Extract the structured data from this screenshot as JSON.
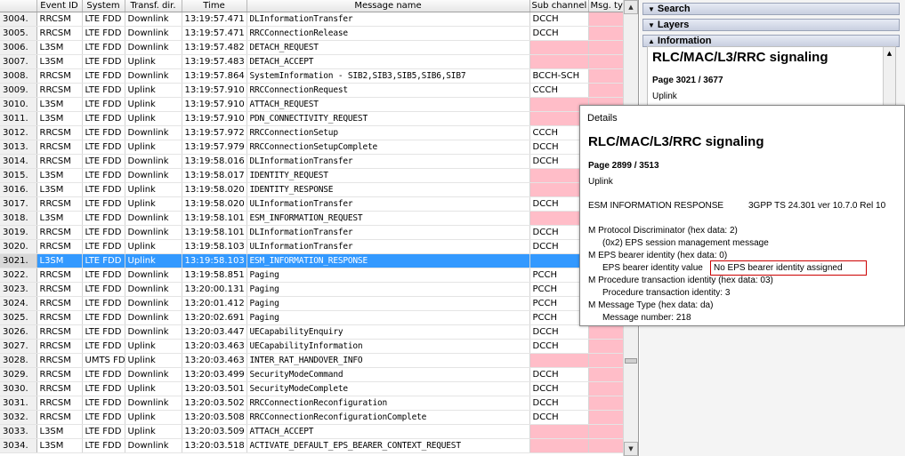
{
  "table": {
    "columns": [
      "",
      "Event ID",
      "System",
      "Transf. dir.",
      "Time",
      "Message name",
      "Sub channel",
      "Msg. ty"
    ],
    "rows": [
      {
        "num": "3004.",
        "event": "RRCSM",
        "system": "LTE FDD",
        "dir": "Downlink",
        "time": "13:19:57.471",
        "msg": "DLInformationTransfer",
        "sub": "DCCH"
      },
      {
        "num": "3005.",
        "event": "RRCSM",
        "system": "LTE FDD",
        "dir": "Downlink",
        "time": "13:19:57.471",
        "msg": "RRCConnectionRelease",
        "sub": "DCCH"
      },
      {
        "num": "3006.",
        "event": "L3SM",
        "system": "LTE FDD",
        "dir": "Downlink",
        "time": "13:19:57.482",
        "msg": "DETACH_REQUEST",
        "sub": ""
      },
      {
        "num": "3007.",
        "event": "L3SM",
        "system": "LTE FDD",
        "dir": "Uplink",
        "time": "13:19:57.483",
        "msg": "DETACH_ACCEPT",
        "sub": ""
      },
      {
        "num": "3008.",
        "event": "RRCSM",
        "system": "LTE FDD",
        "dir": "Downlink",
        "time": "13:19:57.864",
        "msg": "SystemInformation - SIB2,SIB3,SIB5,SIB6,SIB7",
        "sub": "BCCH-SCH"
      },
      {
        "num": "3009.",
        "event": "RRCSM",
        "system": "LTE FDD",
        "dir": "Uplink",
        "time": "13:19:57.910",
        "msg": "RRCConnectionRequest",
        "sub": "CCCH"
      },
      {
        "num": "3010.",
        "event": "L3SM",
        "system": "LTE FDD",
        "dir": "Uplink",
        "time": "13:19:57.910",
        "msg": "ATTACH_REQUEST",
        "sub": ""
      },
      {
        "num": "3011.",
        "event": "L3SM",
        "system": "LTE FDD",
        "dir": "Uplink",
        "time": "13:19:57.910",
        "msg": "PDN_CONNECTIVITY_REQUEST",
        "sub": ""
      },
      {
        "num": "3012.",
        "event": "RRCSM",
        "system": "LTE FDD",
        "dir": "Downlink",
        "time": "13:19:57.972",
        "msg": "RRCConnectionSetup",
        "sub": "CCCH"
      },
      {
        "num": "3013.",
        "event": "RRCSM",
        "system": "LTE FDD",
        "dir": "Uplink",
        "time": "13:19:57.979",
        "msg": "RRCConnectionSetupComplete",
        "sub": "DCCH"
      },
      {
        "num": "3014.",
        "event": "RRCSM",
        "system": "LTE FDD",
        "dir": "Downlink",
        "time": "13:19:58.016",
        "msg": "DLInformationTransfer",
        "sub": "DCCH"
      },
      {
        "num": "3015.",
        "event": "L3SM",
        "system": "LTE FDD",
        "dir": "Downlink",
        "time": "13:19:58.017",
        "msg": "IDENTITY_REQUEST",
        "sub": ""
      },
      {
        "num": "3016.",
        "event": "L3SM",
        "system": "LTE FDD",
        "dir": "Uplink",
        "time": "13:19:58.020",
        "msg": "IDENTITY_RESPONSE",
        "sub": ""
      },
      {
        "num": "3017.",
        "event": "RRCSM",
        "system": "LTE FDD",
        "dir": "Uplink",
        "time": "13:19:58.020",
        "msg": "ULInformationTransfer",
        "sub": "DCCH"
      },
      {
        "num": "3018.",
        "event": "L3SM",
        "system": "LTE FDD",
        "dir": "Downlink",
        "time": "13:19:58.101",
        "msg": "ESM_INFORMATION_REQUEST",
        "sub": ""
      },
      {
        "num": "3019.",
        "event": "RRCSM",
        "system": "LTE FDD",
        "dir": "Downlink",
        "time": "13:19:58.101",
        "msg": "DLInformationTransfer",
        "sub": "DCCH"
      },
      {
        "num": "3020.",
        "event": "RRCSM",
        "system": "LTE FDD",
        "dir": "Uplink",
        "time": "13:19:58.103",
        "msg": "ULInformationTransfer",
        "sub": "DCCH"
      },
      {
        "num": "3021.",
        "event": "L3SM",
        "system": "LTE FDD",
        "dir": "Uplink",
        "time": "13:19:58.103",
        "msg": "ESM_INFORMATION_RESPONSE",
        "sub": "",
        "selected": true
      },
      {
        "num": "3022.",
        "event": "RRCSM",
        "system": "LTE FDD",
        "dir": "Downlink",
        "time": "13:19:58.851",
        "msg": "Paging",
        "sub": "PCCH"
      },
      {
        "num": "3023.",
        "event": "RRCSM",
        "system": "LTE FDD",
        "dir": "Downlink",
        "time": "13:20:00.131",
        "msg": "Paging",
        "sub": "PCCH"
      },
      {
        "num": "3024.",
        "event": "RRCSM",
        "system": "LTE FDD",
        "dir": "Downlink",
        "time": "13:20:01.412",
        "msg": "Paging",
        "sub": "PCCH"
      },
      {
        "num": "3025.",
        "event": "RRCSM",
        "system": "LTE FDD",
        "dir": "Downlink",
        "time": "13:20:02.691",
        "msg": "Paging",
        "sub": "PCCH"
      },
      {
        "num": "3026.",
        "event": "RRCSM",
        "system": "LTE FDD",
        "dir": "Downlink",
        "time": "13:20:03.447",
        "msg": "UECapabilityEnquiry",
        "sub": "DCCH"
      },
      {
        "num": "3027.",
        "event": "RRCSM",
        "system": "LTE FDD",
        "dir": "Uplink",
        "time": "13:20:03.463",
        "msg": "UECapabilityInformation",
        "sub": "DCCH"
      },
      {
        "num": "3028.",
        "event": "RRCSM",
        "system": "UMTS FD",
        "dir": "Uplink",
        "time": "13:20:03.463",
        "msg": "INTER_RAT_HANDOVER_INFO",
        "sub": ""
      },
      {
        "num": "3029.",
        "event": "RRCSM",
        "system": "LTE FDD",
        "dir": "Downlink",
        "time": "13:20:03.499",
        "msg": "SecurityModeCommand",
        "sub": "DCCH"
      },
      {
        "num": "3030.",
        "event": "RRCSM",
        "system": "LTE FDD",
        "dir": "Uplink",
        "time": "13:20:03.501",
        "msg": "SecurityModeComplete",
        "sub": "DCCH"
      },
      {
        "num": "3031.",
        "event": "RRCSM",
        "system": "LTE FDD",
        "dir": "Downlink",
        "time": "13:20:03.502",
        "msg": "RRCConnectionReconfiguration",
        "sub": "DCCH"
      },
      {
        "num": "3032.",
        "event": "RRCSM",
        "system": "LTE FDD",
        "dir": "Uplink",
        "time": "13:20:03.508",
        "msg": "RRCConnectionReconfigurationComplete",
        "sub": "DCCH"
      },
      {
        "num": "3033.",
        "event": "L3SM",
        "system": "LTE FDD",
        "dir": "Uplink",
        "time": "13:20:03.509",
        "msg": "ATTACH_ACCEPT",
        "sub": ""
      },
      {
        "num": "3034.",
        "event": "L3SM",
        "system": "LTE FDD",
        "dir": "Downlink",
        "time": "13:20:03.518",
        "msg": "ACTIVATE_DEFAULT_EPS_BEARER_CONTEXT_REQUEST",
        "sub": ""
      }
    ]
  },
  "sidebar": {
    "search_label": "Search",
    "layers_label": "Layers",
    "information_label": "Information",
    "info_title": "RLC/MAC/L3/RRC signaling",
    "info_page": "Page 3021 / 3677",
    "info_direction": "Uplink"
  },
  "details": {
    "header": "Details",
    "title": "RLC/MAC/L3/RRC signaling",
    "page": "Page 2899 / 3513",
    "direction": "Uplink",
    "message": "ESM INFORMATION RESPONSE",
    "spec": "3GPP TS 24.301 ver 10.7.0 Rel 10",
    "lines": [
      "M Protocol Discriminator (hex data: 2)",
      "(0x2) EPS session management message",
      "M EPS bearer identity (hex data: 0)",
      "EPS bearer identity value",
      "No EPS bearer identity assigned",
      "M Procedure transaction identity (hex data: 03)",
      "Procedure transaction identity: 3",
      "M Message Type (hex data: da)",
      "Message number: 218"
    ]
  },
  "colors": {
    "selection": "#3399ff",
    "msg_type_cell": "#ffbdc8",
    "highlight_border": "#cc0000"
  }
}
